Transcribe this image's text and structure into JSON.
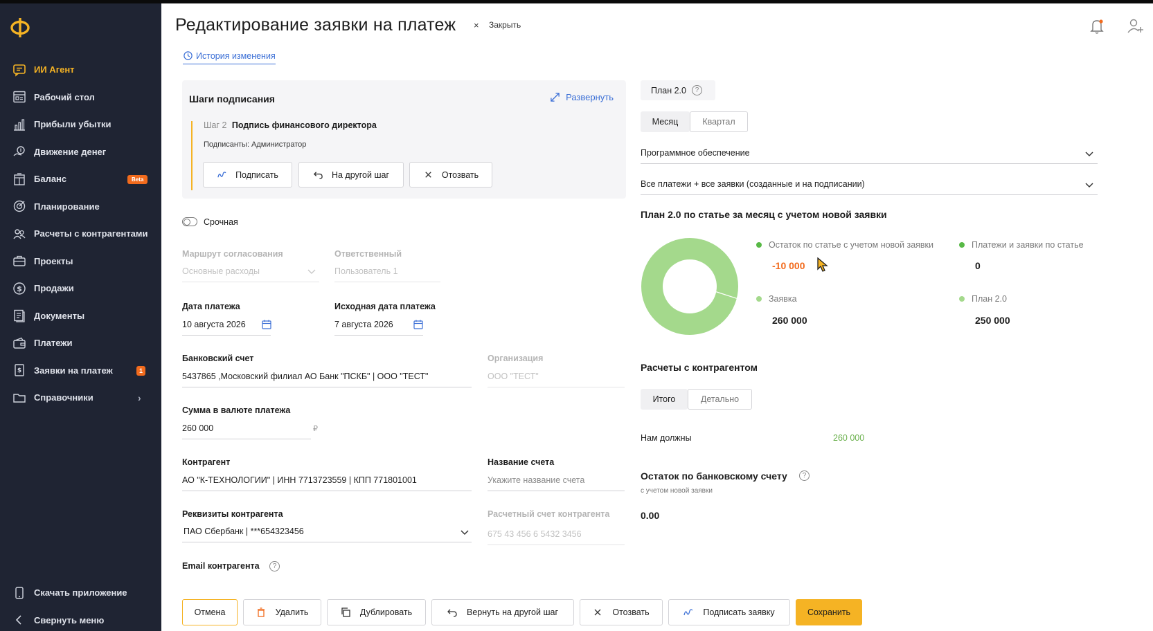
{
  "header": {
    "title": "Редактирование заявки на платеж",
    "close_x": "×",
    "close_label": "Закрыть",
    "history_link": "История изменения"
  },
  "sidebar": {
    "logo": "Ф",
    "items": [
      {
        "label": "ИИ Агент",
        "icon": "chat-icon",
        "active": true
      },
      {
        "label": "Рабочий стол",
        "icon": "desktop-icon"
      },
      {
        "label": "Прибыли убытки",
        "icon": "bar-chart-icon"
      },
      {
        "label": "Движение денег",
        "icon": "money-flow-icon"
      },
      {
        "label": "Баланс",
        "icon": "balance-icon",
        "badge": "Beta"
      },
      {
        "label": "Планирование",
        "icon": "target-icon"
      },
      {
        "label": "Расчеты с контрагентами",
        "icon": "people-icon"
      },
      {
        "label": "Проекты",
        "icon": "briefcase-icon"
      },
      {
        "label": "Продажи",
        "icon": "dollar-icon"
      },
      {
        "label": "Документы",
        "icon": "documents-icon"
      },
      {
        "label": "Платежи",
        "icon": "wallet-icon"
      },
      {
        "label": "Заявки на платеж",
        "icon": "request-icon",
        "count": "1"
      },
      {
        "label": "Справочники",
        "icon": "folder-icon",
        "chevron": "›"
      }
    ],
    "bottom": [
      {
        "label": "Скачать приложение",
        "icon": "phone-icon"
      },
      {
        "label": "Свернуть меню",
        "icon": "chevron-left-icon"
      }
    ]
  },
  "steps": {
    "title": "Шаги подписания",
    "expand_label": "Развернуть",
    "step_prefix": "Шаг 2",
    "step_name": "Подпись финансового директора",
    "signers": "Подписанты: Администратор",
    "buttons": {
      "sign": "Подписать",
      "other_step": "На другой шаг",
      "revoke": "Отозвать"
    }
  },
  "form": {
    "urgent_label": "Срочная",
    "route": {
      "label": "Маршрут согласования",
      "value": "Основные расходы"
    },
    "responsible": {
      "label": "Ответственный",
      "value": "Пользователь 1"
    },
    "pay_date": {
      "label": "Дата платежа",
      "value": "10 августа 2026"
    },
    "orig_date": {
      "label": "Исходная дата платежа",
      "value": "7 августа 2026"
    },
    "bank_account": {
      "label": "Банковский счет",
      "value": "5437865 ,Московский филиал АО Банк \"ПСКБ\" | ООО \"ТЕСТ\""
    },
    "organization": {
      "label": "Организация",
      "value": "ООО \"ТЕСТ\""
    },
    "amount": {
      "label": "Сумма в валюте платежа",
      "value": "260 000",
      "currency": "₽"
    },
    "counterparty": {
      "label": "Контрагент",
      "value": "АО \"К-ТЕХНОЛОГИИ\" | ИНН 7713723559 | КПП 771801001"
    },
    "account_name": {
      "label": "Название счета",
      "placeholder": "Укажите название счета"
    },
    "cp_details": {
      "label": "Реквизиты контрагента",
      "value": "ПАО Сбербанк | ***654323456"
    },
    "cp_account": {
      "label": "Расчетный счет контрагента",
      "value": "675 43 456 6 5432 3456"
    },
    "email": {
      "label": "Email контрагента"
    }
  },
  "footer": {
    "cancel": "Отмена",
    "delete": "Удалить",
    "duplicate": "Дублировать",
    "return_step": "Вернуть на другой шаг",
    "revoke": "Отозвать",
    "sign_request": "Подписать заявку",
    "save": "Сохранить"
  },
  "right": {
    "plan_chip": "План 2.0",
    "period_tabs": {
      "month": "Месяц",
      "quarter": "Квартал"
    },
    "category_select": "Программное обеспечение",
    "payments_select": "Все платежи + все заявки (созданные и на подписании)",
    "plan_title": "План 2.0 по статье за месяц с учетом новой заявки",
    "legend": {
      "remaining_label": "Остаток по статье с учетом новой заявки",
      "remaining_value": "-10 000",
      "payments_label": "Платежи и заявки по статье",
      "payments_value": "0",
      "request_label": "Заявка",
      "request_value": "260 000",
      "plan_label": "План 2.0",
      "plan_value": "250 000"
    },
    "settlements_title": "Расчеты с контрагентом",
    "settlement_tabs": {
      "total": "Итого",
      "detail": "Детально"
    },
    "owed_label": "Нам должны",
    "owed_value": "260 000",
    "bank_balance_title": "Остаток по банковскому счету",
    "bank_balance_sub": "с учетом новой заявки",
    "bank_balance_value": "0.00"
  },
  "chart_data": {
    "type": "pie",
    "variant": "donut",
    "slices": [
      {
        "label": "Заявка",
        "value": 260000
      },
      {
        "label": "Платежи и заявки по статье",
        "value": 0
      }
    ]
  },
  "colors": {
    "sidebar_bg": "#1f2433",
    "accent": "#f5b324",
    "link": "#3b6fd6",
    "negative": "#f26b1d",
    "donut": "#a4d98c",
    "legend_dot": "#58b946"
  }
}
